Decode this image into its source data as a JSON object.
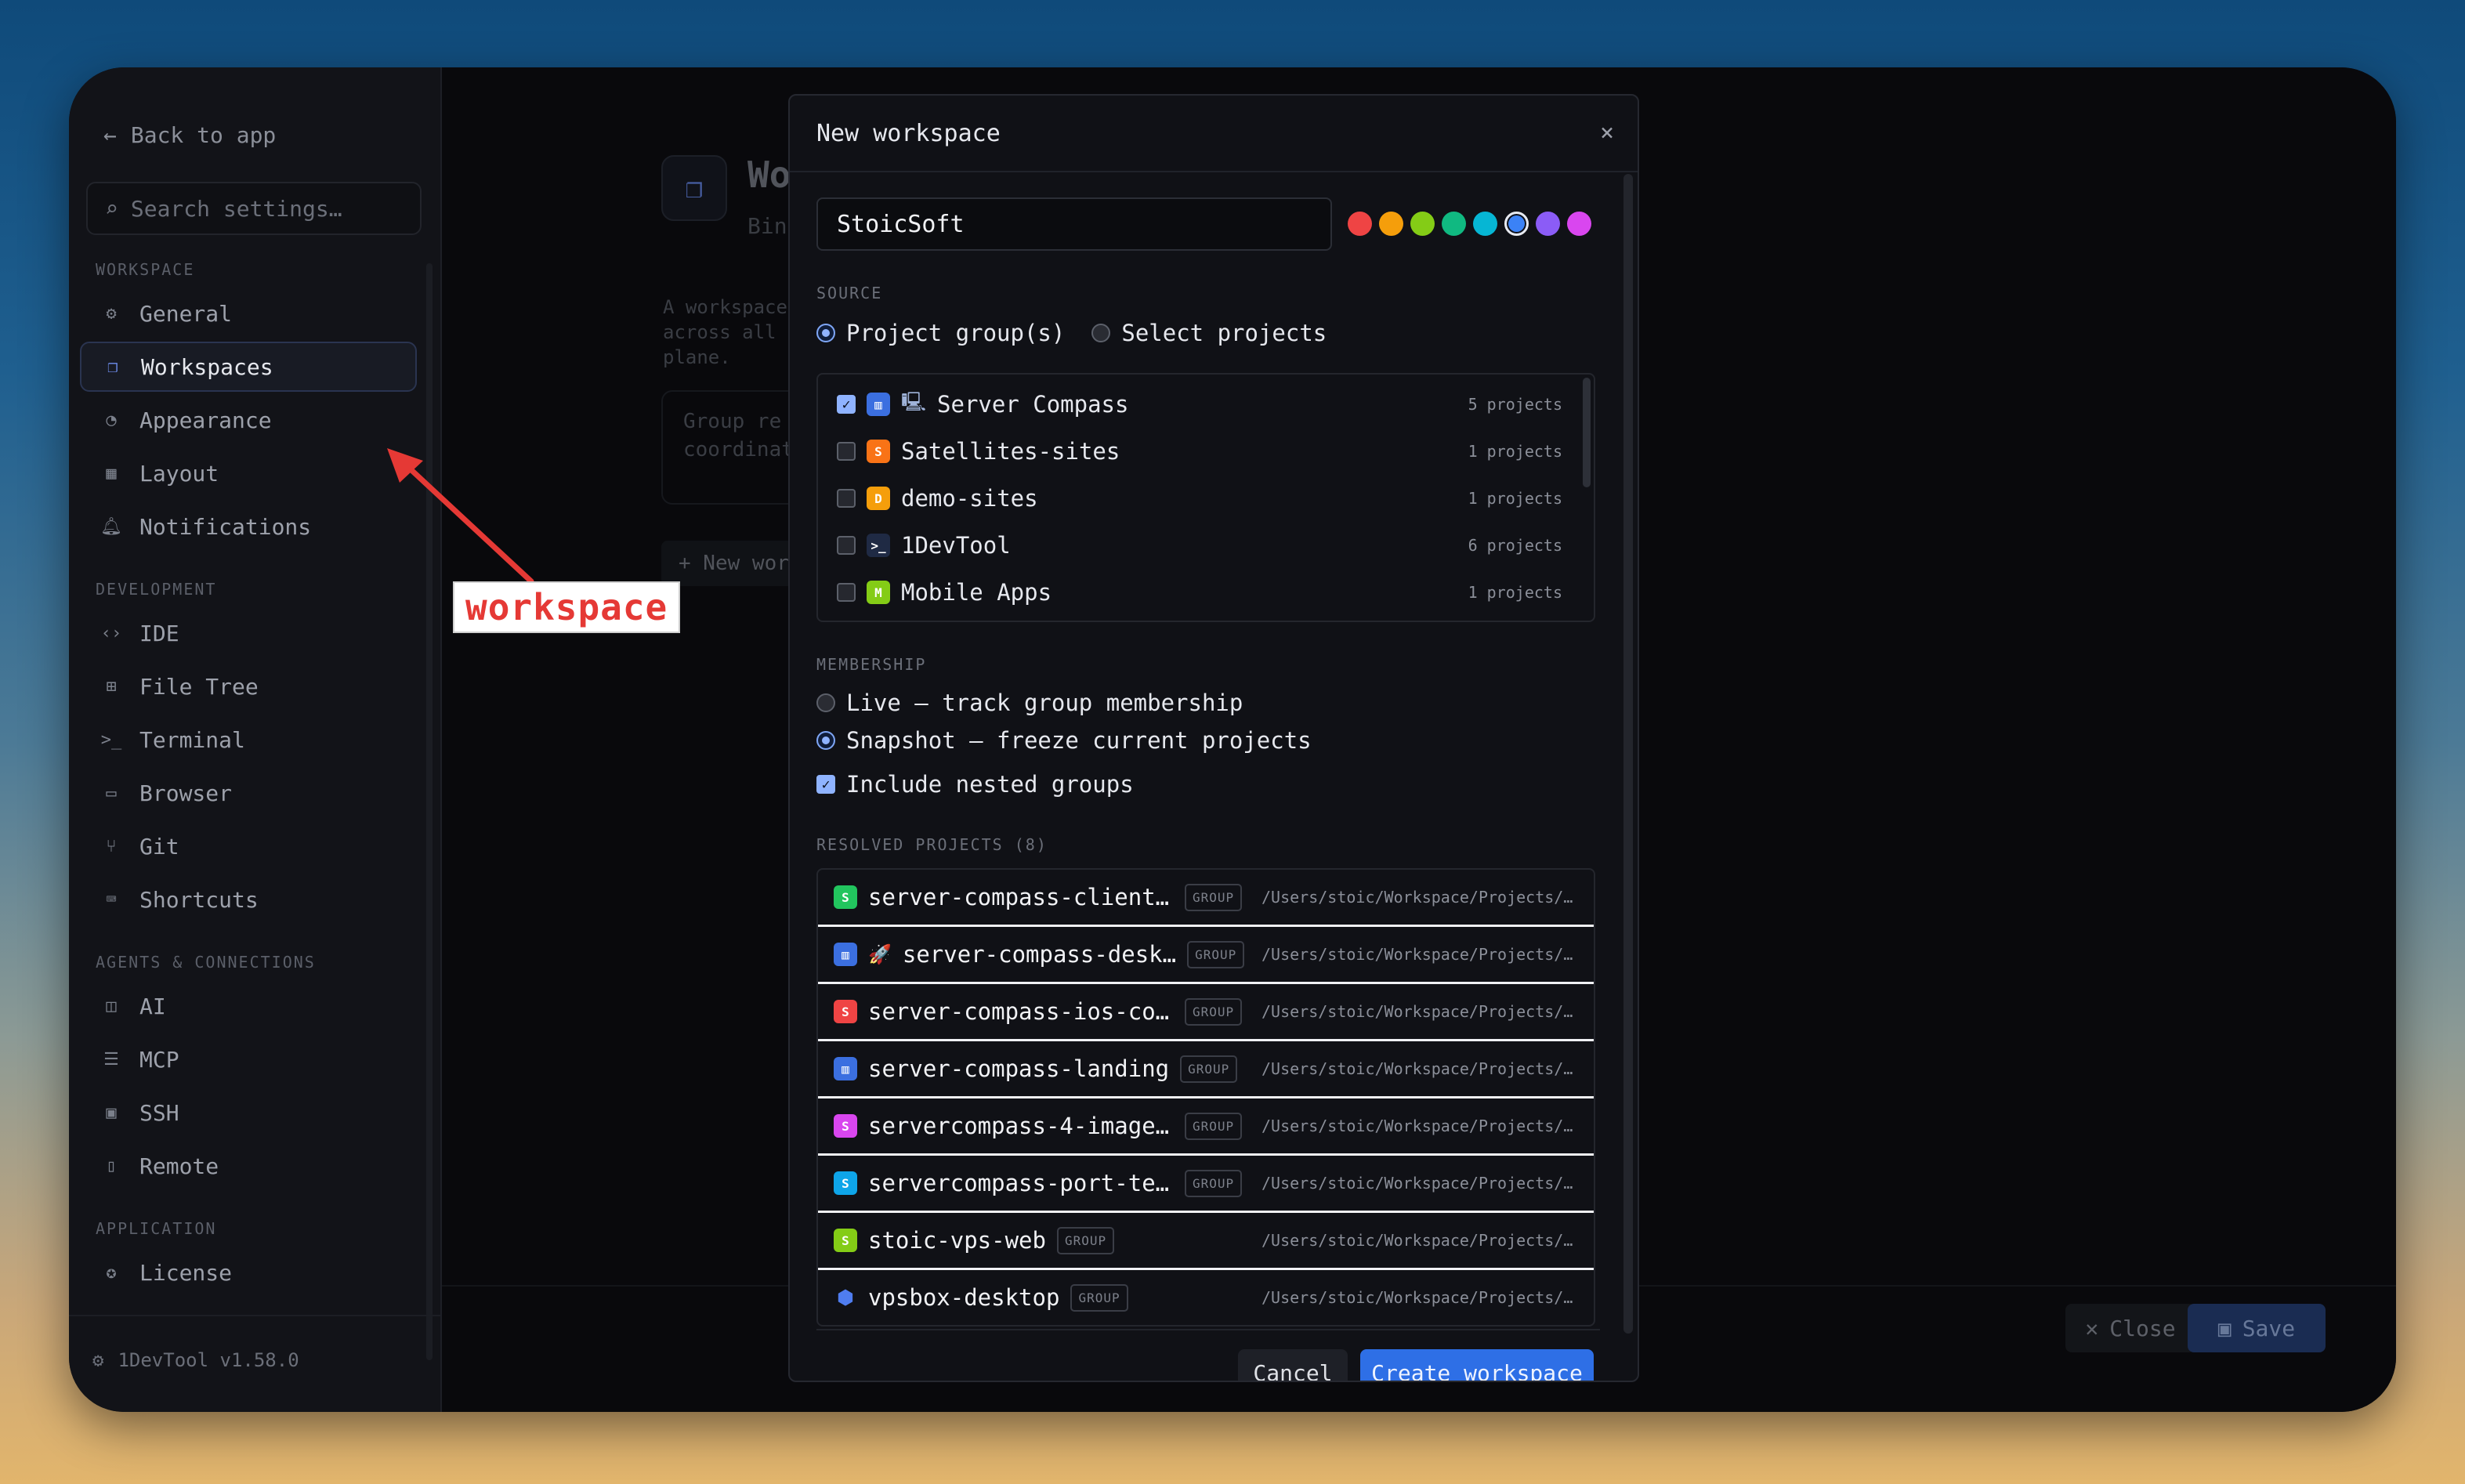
{
  "sidebar": {
    "back_label": "Back to app",
    "search_placeholder": "Search settings…",
    "sections": [
      {
        "label": "WORKSPACE"
      },
      {
        "label": "DEVELOPMENT"
      },
      {
        "label": "AGENTS & CONNECTIONS"
      },
      {
        "label": "APPLICATION"
      }
    ],
    "items": [
      {
        "label": "General",
        "icon": "gear-icon"
      },
      {
        "label": "Workspaces",
        "icon": "workspaces-icon",
        "active": true
      },
      {
        "label": "Appearance",
        "icon": "palette-icon"
      },
      {
        "label": "Layout",
        "icon": "layout-icon"
      },
      {
        "label": "Notifications",
        "icon": "bell-icon"
      },
      {
        "label": "IDE",
        "icon": "code-icon"
      },
      {
        "label": "File Tree",
        "icon": "file-tree-icon"
      },
      {
        "label": "Terminal",
        "icon": "terminal-icon"
      },
      {
        "label": "Browser",
        "icon": "browser-icon"
      },
      {
        "label": "Git",
        "icon": "git-icon"
      },
      {
        "label": "Shortcuts",
        "icon": "keyboard-icon"
      },
      {
        "label": "AI",
        "icon": "robot-icon"
      },
      {
        "label": "MCP",
        "icon": "server-icon"
      },
      {
        "label": "SSH",
        "icon": "ssh-icon"
      },
      {
        "label": "Remote",
        "icon": "phone-icon"
      },
      {
        "label": "License",
        "icon": "license-icon"
      }
    ],
    "version": "1DevTool v1.58.0"
  },
  "main": {
    "title": "Wo",
    "subtitle": "Bin",
    "description": "A workspace\nacross all c\nplane.",
    "group_box_text": "Group re\ncoordinat",
    "new_button": "+ New wor",
    "close_label": "Close",
    "save_label": "Save"
  },
  "modal": {
    "title": "New workspace",
    "close_glyph": "×",
    "name_value": "StoicSoft",
    "colors": [
      "#ef4444",
      "#f59e0b",
      "#84cc16",
      "#10b981",
      "#06b6d4",
      "#3b82f6",
      "#8b5cf6",
      "#d946ef"
    ],
    "selected_color_index": 5,
    "source_label": "SOURCE",
    "source_options": [
      {
        "label": "Project group(s)",
        "selected": true
      },
      {
        "label": "Select projects",
        "selected": false
      }
    ],
    "groups": [
      {
        "name": "Server Compass",
        "count": "5 projects",
        "checked": true,
        "badge": "▥",
        "badge_color": "#3b6fe0",
        "emoji": "🖳"
      },
      {
        "name": "Satellites-sites",
        "count": "1 projects",
        "checked": false,
        "badge": "S",
        "badge_color": "#f97316"
      },
      {
        "name": "demo-sites",
        "count": "1 projects",
        "checked": false,
        "badge": "D",
        "badge_color": "#f59e0b"
      },
      {
        "name": "1DevTool",
        "count": "6 projects",
        "checked": false,
        "badge": ">_",
        "badge_color": "#1f2a44"
      },
      {
        "name": "Mobile Apps",
        "count": "1 projects",
        "checked": false,
        "badge": "M",
        "badge_color": "#84cc16"
      }
    ],
    "membership_label": "MEMBERSHIP",
    "membership_options": [
      {
        "label": "Live — track group membership",
        "selected": false
      },
      {
        "label": "Snapshot — freeze current projects",
        "selected": true
      }
    ],
    "nested_label": "Include nested groups",
    "nested_checked": true,
    "resolved_label": "RESOLVED PROJECTS (8)",
    "group_tag": "GROUP",
    "projects": [
      {
        "name": "server-compass-client-…",
        "badge": "S",
        "badge_color": "#22c55e",
        "path": "/Users/stoic/Workspace/Projects/…"
      },
      {
        "name": "server-compass-desk…",
        "badge": "▥",
        "badge_color": "#3b6fe0",
        "emoji": "🚀",
        "path": "/Users/stoic/Workspace/Projects/…"
      },
      {
        "name": "server-compass-ios-code",
        "badge": "S",
        "badge_color": "#ef4444",
        "path": "/Users/stoic/Workspace/Projects/…"
      },
      {
        "name": "server-compass-landing",
        "badge": "▥",
        "badge_color": "#3b6fe0",
        "path": "/Users/stoic/Workspace/Projects/…"
      },
      {
        "name": "servercompass-4-images…",
        "badge": "S",
        "badge_color": "#d946ef",
        "path": "/Users/stoic/Workspace/Projects/…"
      },
      {
        "name": "servercompass-port-tes…",
        "badge": "S",
        "badge_color": "#0ea5e9",
        "path": "/Users/stoic/Workspace/Projects/…"
      },
      {
        "name": "stoic-vps-web",
        "badge": "S",
        "badge_color": "#84cc16",
        "path": "/Users/stoic/Workspace/Projects/…"
      },
      {
        "name": "vpsbox-desktop",
        "badge": "⬢",
        "badge_color": "transparent",
        "path": "/Users/stoic/Workspace/Projects/…"
      }
    ],
    "cancel_label": "Cancel",
    "create_label": "Create workspace"
  },
  "annotation": {
    "text": "workspace",
    "color": "#e53935"
  }
}
